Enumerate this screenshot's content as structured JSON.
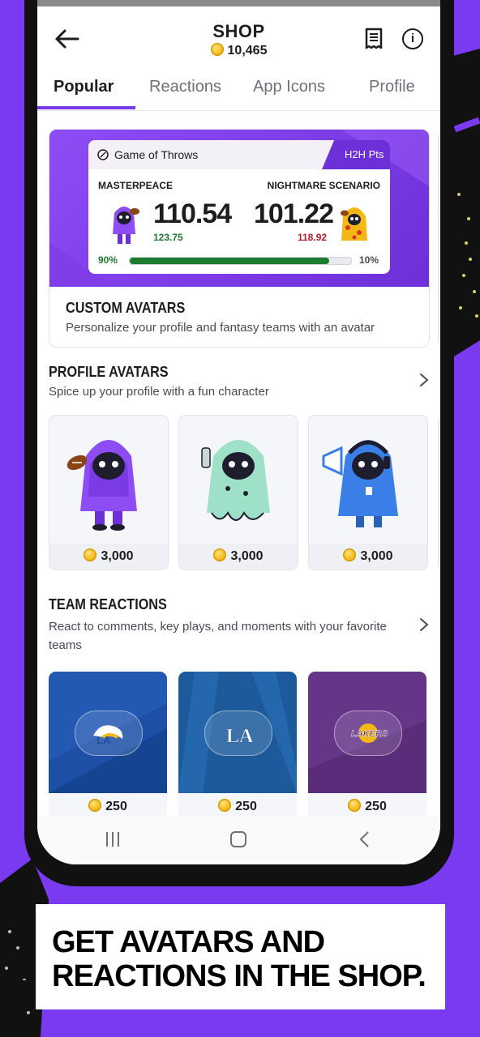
{
  "header": {
    "title": "SHOP",
    "coin_balance": "10,465"
  },
  "tabs": [
    {
      "label": "Popular",
      "active": true
    },
    {
      "label": "Reactions",
      "active": false
    },
    {
      "label": "App Icons",
      "active": false
    },
    {
      "label": "Profile",
      "active": false
    }
  ],
  "custom_avatars": {
    "matchup": {
      "league": "Game of Throws",
      "badge": "H2H Pts",
      "team_left": {
        "name": "MASTERPEACE",
        "score": "110.54",
        "projected": "123.75",
        "win_pct": "90%"
      },
      "team_right": {
        "name": "NIGHTMARE SCENARIO",
        "score": "101.22",
        "projected": "118.92",
        "win_pct": "10%"
      },
      "win_probability": 0.9
    },
    "title": "CUSTOM AVATARS",
    "subtitle": "Personalize your profile and fantasy teams with an avatar"
  },
  "profile_avatars": {
    "title": "PROFILE AVATARS",
    "subtitle": "Spice up your profile with a fun character",
    "items": [
      {
        "name": "football-avatar",
        "price": "3,000",
        "color": "#8e4cf5"
      },
      {
        "name": "spraycan-avatar",
        "price": "3,000",
        "color": "#9fe0c8"
      },
      {
        "name": "megaphone-avatar",
        "price": "3,000",
        "color": "#3a7ee8"
      }
    ]
  },
  "team_reactions": {
    "title": "TEAM REACTIONS",
    "subtitle": "React to comments, key plays, and moments with your favorite teams",
    "items": [
      {
        "team": "Rams",
        "logo_text": "LA",
        "price": "250",
        "bg": "#1d4fa6"
      },
      {
        "team": "Dodgers",
        "logo_text": "LA",
        "price": "250",
        "bg": "#1c5a9c"
      },
      {
        "team": "Lakers",
        "logo_text": "LAKERS",
        "price": "250",
        "bg": "#5a2d7a"
      }
    ]
  },
  "promo_banner": {
    "line1": "GET AVATARS AND",
    "line2": "REACTIONS IN THE SHOP."
  },
  "colors": {
    "brand_purple": "#7a3bf0",
    "win_green": "#1d7b2f",
    "loss_red": "#b01c2a"
  }
}
